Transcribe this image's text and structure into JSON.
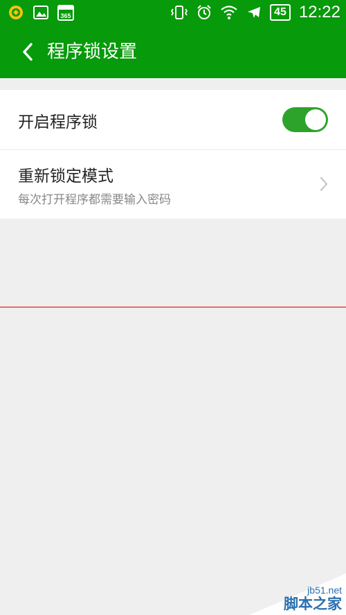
{
  "status_bar": {
    "time": "12:22",
    "battery": "45",
    "left_icons": [
      "wallet-icon",
      "gallery-icon",
      "calendar-365-icon"
    ],
    "right_icons": [
      "vibrate-icon",
      "alarm-icon",
      "wifi-icon",
      "airplane-icon"
    ],
    "calendar_text": "365"
  },
  "header": {
    "title": "程序锁设置",
    "background": "#079a0a"
  },
  "settings": {
    "enable_lock": {
      "label": "开启程序锁",
      "enabled": true
    },
    "relock_mode": {
      "title": "重新锁定模式",
      "subtitle": "每次打开程序都需要输入密码"
    }
  },
  "watermark": {
    "site": "jb51.net",
    "brand": "脚本之家"
  }
}
